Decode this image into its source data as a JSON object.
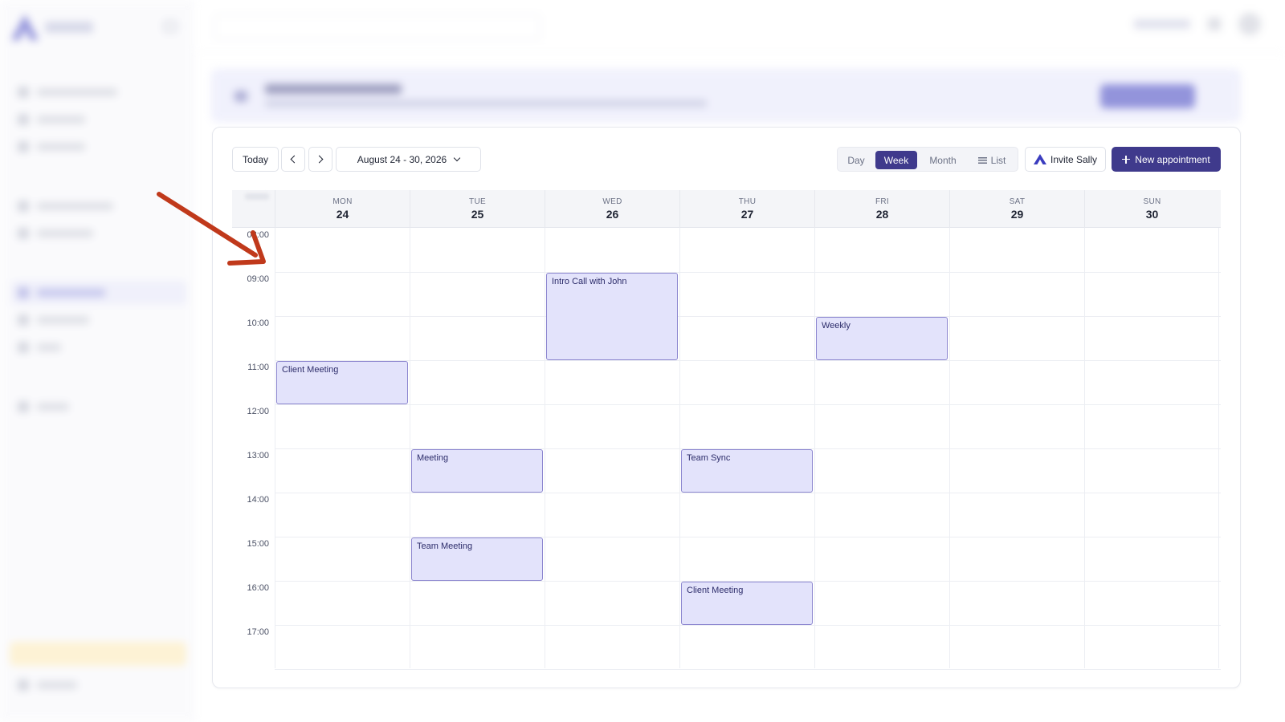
{
  "calendar": {
    "toolbar": {
      "today": "Today",
      "range": "August 24 - 30, 2026",
      "views": {
        "day": "Day",
        "week": "Week",
        "month": "Month",
        "list": "List"
      },
      "active_view": "Week",
      "invite": "Invite Sally",
      "new_appointment": "New appointment"
    },
    "days": [
      {
        "dow": "MON",
        "num": "24"
      },
      {
        "dow": "TUE",
        "num": "25"
      },
      {
        "dow": "WED",
        "num": "26"
      },
      {
        "dow": "THU",
        "num": "27"
      },
      {
        "dow": "FRI",
        "num": "28"
      },
      {
        "dow": "SAT",
        "num": "29"
      },
      {
        "dow": "SUN",
        "num": "30"
      }
    ],
    "hours": [
      "08:00",
      "09:00",
      "10:00",
      "11:00",
      "12:00",
      "13:00",
      "14:00",
      "15:00",
      "16:00",
      "17:00"
    ],
    "events": [
      {
        "title": "Intro Call with John",
        "day": "WED",
        "start": "09:00",
        "end": "11:00"
      },
      {
        "title": "Weekly",
        "day": "FRI",
        "start": "10:00",
        "end": "11:00"
      },
      {
        "title": "Client Meeting",
        "day": "MON",
        "start": "11:00",
        "end": "12:00"
      },
      {
        "title": "Meeting",
        "day": "TUE",
        "start": "13:00",
        "end": "14:00"
      },
      {
        "title": "Team Sync",
        "day": "THU",
        "start": "13:00",
        "end": "14:00"
      },
      {
        "title": "Team Meeting",
        "day": "TUE",
        "start": "15:00",
        "end": "16:00"
      },
      {
        "title": "Client Meeting",
        "day": "THU",
        "start": "16:00",
        "end": "17:00"
      }
    ]
  },
  "colors": {
    "accent": "#3f3a8c",
    "event_fill": "#e3e3fb",
    "event_border": "#8c86cf",
    "annotation_arrow": "#c0391b"
  },
  "icons": [
    "chevron-left-icon",
    "chevron-right-icon",
    "chevron-down-icon",
    "list-icon",
    "invite-logo-icon",
    "plus-icon",
    "annotation-arrow-icon"
  ]
}
